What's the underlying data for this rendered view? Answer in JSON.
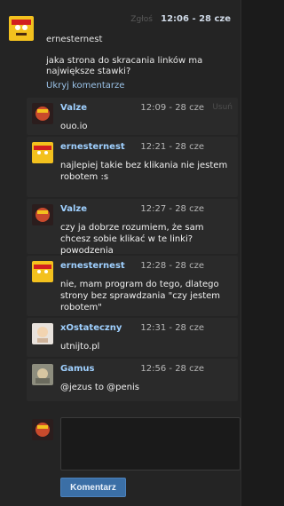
{
  "thread": {
    "report_label": "Zgłoś",
    "time": "12:06 - 28 cze",
    "author": "ernesternest",
    "text": "jaka strona do skracania linków ma największe stawki?",
    "collapse_label": "Ukryj komentarze"
  },
  "replies": [
    {
      "author": "Valze",
      "time": "12:09 - 28 cze",
      "action": "Usuń",
      "text": "ouo.io"
    },
    {
      "author": "ernesternest",
      "time": "12:21 - 28 cze",
      "action": "",
      "text": "najlepiej takie bez klikania nie jestem robotem :s"
    },
    {
      "author": "Valze",
      "time": "12:27 - 28 cze",
      "action": "",
      "text": "czy ja dobrze rozumiem, że sam chcesz sobie klikać w te linki? powodzenia"
    },
    {
      "author": "ernesternest",
      "time": "12:28 - 28 cze",
      "action": "",
      "text": "nie, mam program do tego, dlatego strony bez sprawdzania \"czy jestem robotem\""
    },
    {
      "author": "xOstateczny",
      "time": "12:31 - 28 cze",
      "action": "",
      "text": "utnijto.pl"
    },
    {
      "author": "Gamus",
      "time": "12:56 - 28 cze",
      "action": "",
      "text": "@jezus to @penis"
    }
  ],
  "composer": {
    "placeholder": "",
    "submit_label": "Komentarz"
  },
  "colors": {
    "accent": "#9fd0ff",
    "button": "#3b6fa6"
  }
}
